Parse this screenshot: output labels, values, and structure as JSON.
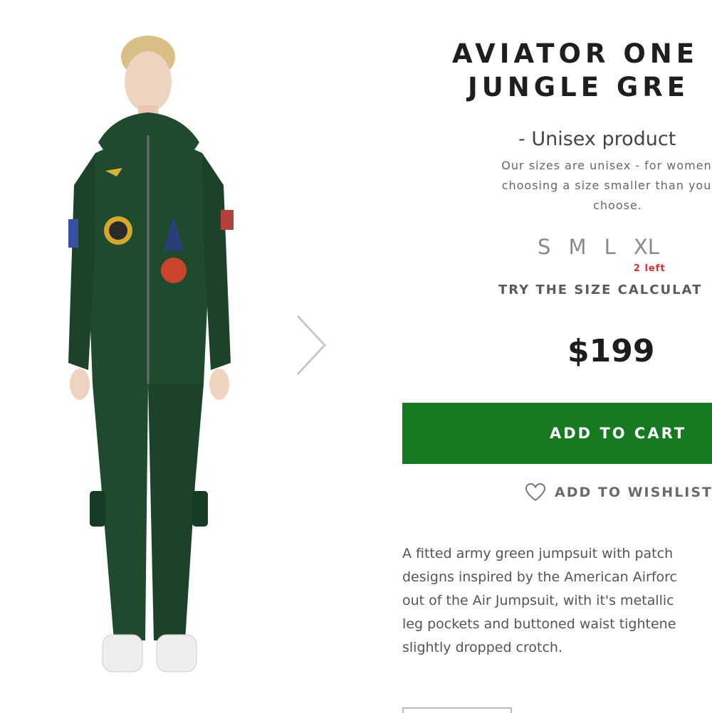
{
  "product": {
    "title_line1": "AVIATOR ONE",
    "title_line2": "JUNGLE GRE",
    "unisex_label": "- Unisex product",
    "size_note_line1": "Our sizes are unisex - for women we",
    "size_note_line2": "choosing a size smaller than you wo",
    "size_note_line3": "choose.",
    "sizes": [
      {
        "label": "S"
      },
      {
        "label": "M"
      },
      {
        "label": "L"
      },
      {
        "label": "XL",
        "stock": "2 left"
      }
    ],
    "size_calculator": "TRY THE SIZE CALCULAT",
    "price": "$199",
    "add_to_cart": "ADD TO CART",
    "add_to_wishlist": "ADD TO WISHLIST",
    "description_lines": [
      "A fitted army green jumpsuit with patch",
      "designs inspired by the American Airforc",
      "out of the Air Jumpsuit, with it's metallic",
      "leg pockets and buttoned waist tightene",
      "slightly dropped crotch."
    ]
  },
  "colors": {
    "accent": "#157a22",
    "stock_warning": "#d0312d",
    "jumpsuit": "#1f4a2e"
  },
  "icons": {
    "next": "chevron-right-icon",
    "wishlist": "heart-outline-icon"
  }
}
